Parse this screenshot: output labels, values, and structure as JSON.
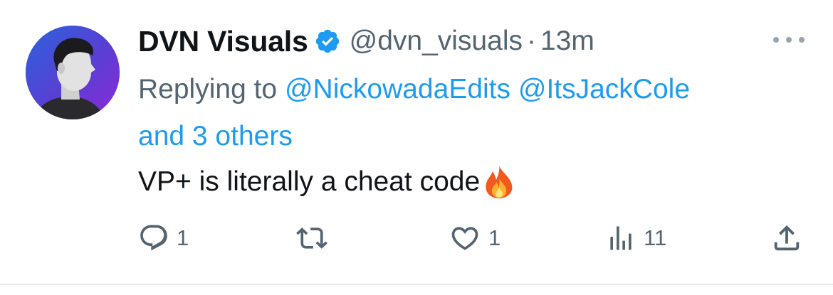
{
  "tweet": {
    "author": {
      "display_name": "DVN Visuals",
      "handle": "@dvn_visuals",
      "verified": true,
      "verified_color": "#1d9bf0"
    },
    "separator": "·",
    "timestamp": "13m",
    "reply_prefix": "Replying to",
    "reply_to": [
      {
        "text": "@NickowadaEdits"
      },
      {
        "text": "@ItsJackCole"
      },
      {
        "text": "and 3 others"
      }
    ],
    "text": "VP+ is literally a cheat code",
    "emoji": "fire-emoji",
    "actions": {
      "reply": {
        "icon": "reply-icon",
        "count": "1"
      },
      "retweet": {
        "icon": "retweet-icon",
        "count": ""
      },
      "like": {
        "icon": "heart-icon",
        "count": "1"
      },
      "views": {
        "icon": "views-icon",
        "count": "11"
      },
      "share": {
        "icon": "share-icon",
        "count": ""
      }
    },
    "colors": {
      "link": "#1d9bf0",
      "muted": "#536471",
      "text": "#0f1419"
    }
  }
}
